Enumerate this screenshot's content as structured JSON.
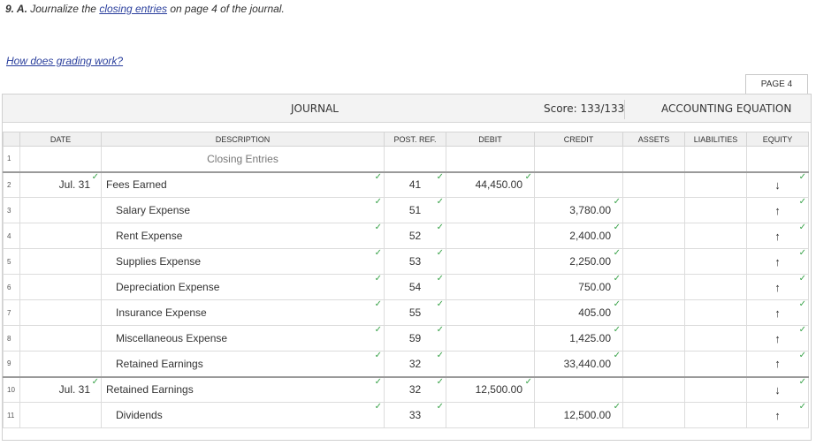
{
  "header": {
    "question_num": "9. A.",
    "question_pre": "Journalize the",
    "question_link": "closing entries",
    "question_post": "on page 4 of the journal.",
    "grading_link": "How does grading work?"
  },
  "page_tab": "PAGE 4",
  "title_bar": {
    "journal": "JOURNAL",
    "score": "Score: 133/133",
    "equation": "ACCOUNTING EQUATION"
  },
  "columns": {
    "date": "DATE",
    "description": "DESCRIPTION",
    "post_ref": "POST. REF.",
    "debit": "DEBIT",
    "credit": "CREDIT",
    "assets": "ASSETS",
    "liabilities": "LIABILITIES",
    "equity": "EQUITY"
  },
  "check_glyph": "✓",
  "rows": [
    {
      "num": "1",
      "date": "",
      "desc": "Closing Entries",
      "ref": "",
      "debit": "",
      "credit": "",
      "equity": ""
    },
    {
      "num": "2",
      "date": "Jul. 31",
      "desc": "Fees Earned",
      "ref": "41",
      "debit": "44,450.00",
      "credit": "",
      "equity": "↓"
    },
    {
      "num": "3",
      "date": "",
      "desc": "Salary Expense",
      "ref": "51",
      "debit": "",
      "credit": "3,780.00",
      "equity": "↑"
    },
    {
      "num": "4",
      "date": "",
      "desc": "Rent Expense",
      "ref": "52",
      "debit": "",
      "credit": "2,400.00",
      "equity": "↑"
    },
    {
      "num": "5",
      "date": "",
      "desc": "Supplies Expense",
      "ref": "53",
      "debit": "",
      "credit": "2,250.00",
      "equity": "↑"
    },
    {
      "num": "6",
      "date": "",
      "desc": "Depreciation Expense",
      "ref": "54",
      "debit": "",
      "credit": "750.00",
      "equity": "↑"
    },
    {
      "num": "7",
      "date": "",
      "desc": "Insurance Expense",
      "ref": "55",
      "debit": "",
      "credit": "405.00",
      "equity": "↑"
    },
    {
      "num": "8",
      "date": "",
      "desc": "Miscellaneous Expense",
      "ref": "59",
      "debit": "",
      "credit": "1,425.00",
      "equity": "↑"
    },
    {
      "num": "9",
      "date": "",
      "desc": "Retained Earnings",
      "ref": "32",
      "debit": "",
      "credit": "33,440.00",
      "equity": "↑"
    },
    {
      "num": "10",
      "date": "Jul. 31",
      "desc": "Retained Earnings",
      "ref": "32",
      "debit": "12,500.00",
      "credit": "",
      "equity": "↓"
    },
    {
      "num": "11",
      "date": "",
      "desc": "Dividends",
      "ref": "33",
      "debit": "",
      "credit": "12,500.00",
      "equity": "↑"
    }
  ]
}
